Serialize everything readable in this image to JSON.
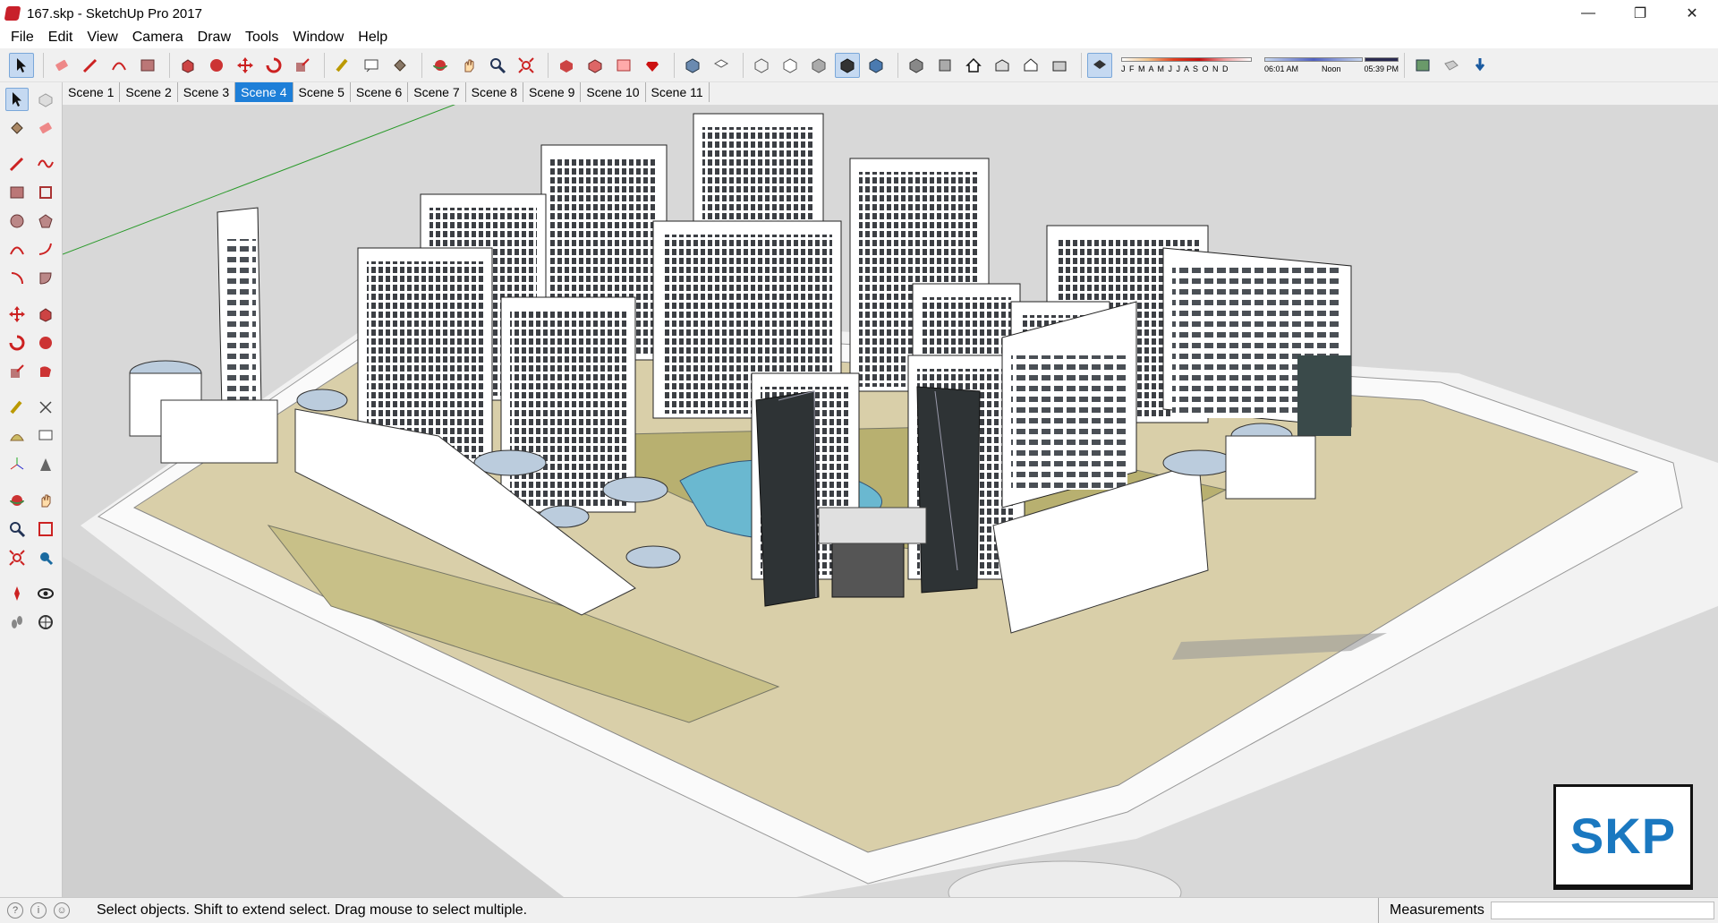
{
  "window": {
    "title": "167.skp - SketchUp Pro 2017",
    "minimize_glyph": "—",
    "restore_glyph": "❐",
    "close_glyph": "✕"
  },
  "menu": [
    "File",
    "Edit",
    "View",
    "Camera",
    "Draw",
    "Tools",
    "Window",
    "Help"
  ],
  "toolbar": {
    "icons": [
      "select-icon",
      "eraser-icon",
      "line-icon",
      "arc-icon",
      "rectangle-icon",
      "push-pull-icon",
      "follow-me-icon",
      "move-icon",
      "rotate-icon",
      "scale-icon",
      "tape-measure-icon",
      "text-icon",
      "paint-bucket-icon",
      "orbit-icon",
      "pan-icon",
      "zoom-icon",
      "zoom-extents-icon",
      "3d-warehouse-icon",
      "extension-warehouse-icon",
      "layout-icon",
      "ruby-icon",
      "iso-view-icon",
      "top-view-icon",
      "front-view-icon",
      "right-view-icon",
      "back-view-icon",
      "left-view-icon",
      "xray-icon",
      "wireframe-icon",
      "hidden-line-icon",
      "shaded-icon",
      "shaded-textures-icon",
      "monochrome-icon",
      "section-plane-icon",
      "section-fill-icon",
      "warehouse-house-icon",
      "component-icon",
      "house-icon",
      "shadows-icon"
    ],
    "shadow_months": "J F M A M J J A S O N D",
    "time_start": "06:01 AM",
    "time_noon": "Noon",
    "time_end": "05:39 PM"
  },
  "scenes": [
    "Scene 1",
    "Scene 2",
    "Scene 3",
    "Scene 4",
    "Scene 5",
    "Scene 6",
    "Scene 7",
    "Scene 8",
    "Scene 9",
    "Scene 10",
    "Scene 11"
  ],
  "active_scene": "Scene 4",
  "left_tools": [
    [
      "select-icon",
      "component-icon"
    ],
    [
      "paint-bucket-icon",
      "eraser-icon"
    ],
    [
      "line-icon",
      "freehand-icon"
    ],
    [
      "rectangle-icon",
      "rotated-rectangle-icon"
    ],
    [
      "circle-icon",
      "polygon-icon"
    ],
    [
      "arc-icon",
      "two-point-arc-icon"
    ],
    [
      "pie-icon",
      "three-point-arc-icon"
    ],
    [
      "move-icon",
      "push-pull-icon"
    ],
    [
      "rotate-icon",
      "follow-me-icon"
    ],
    [
      "scale-icon",
      "offset-icon"
    ],
    [
      "tape-measure-icon",
      "dimension-icon"
    ],
    [
      "protractor-icon",
      "text-icon"
    ],
    [
      "axes-icon",
      "3d-text-icon"
    ],
    [
      "orbit-icon",
      "pan-icon"
    ],
    [
      "zoom-icon",
      "zoom-window-icon"
    ],
    [
      "zoom-extents-icon",
      "previous-view-icon"
    ],
    [
      "position-camera-icon",
      "look-around-icon"
    ],
    [
      "walk-icon",
      "section-plane-icon"
    ]
  ],
  "logo": {
    "text": "SKP"
  },
  "status": {
    "message": "Select objects. Shift to extend select. Drag mouse to select multiple.",
    "measurements_label": "Measurements",
    "measurements_value": ""
  },
  "colors": {
    "accent": "#1e7fd8",
    "viewport_bg": "#d8d8d8",
    "water": "#6ab8d0",
    "lawn": "#b8b070"
  }
}
